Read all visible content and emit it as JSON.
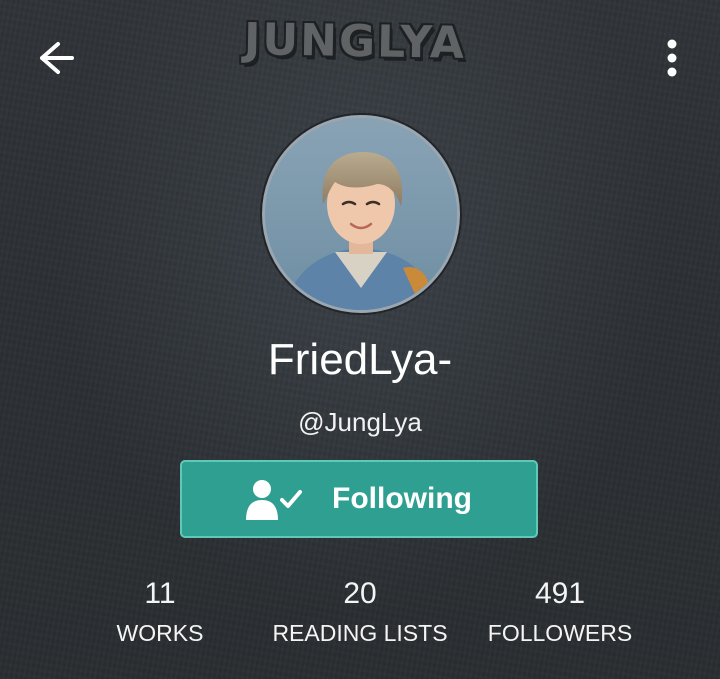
{
  "header": {
    "watermark_text": "JUNGLYA",
    "back_icon": "arrow-left-icon",
    "more_icon": "more-vertical-icon"
  },
  "profile": {
    "display_name": "FriedLya-",
    "username": "@JungLya",
    "follow_button": {
      "label": "Following",
      "icon": "user-check-icon"
    }
  },
  "stats": [
    {
      "value": "11",
      "label": "WORKS"
    },
    {
      "value": "20",
      "label": "READING LISTS"
    },
    {
      "value": "491",
      "label": "FOLLOWERS"
    }
  ],
  "colors": {
    "background": "#2c3034",
    "accent": "#2f9f91",
    "accent_border": "#5fc9b8",
    "text": "#ffffff"
  }
}
